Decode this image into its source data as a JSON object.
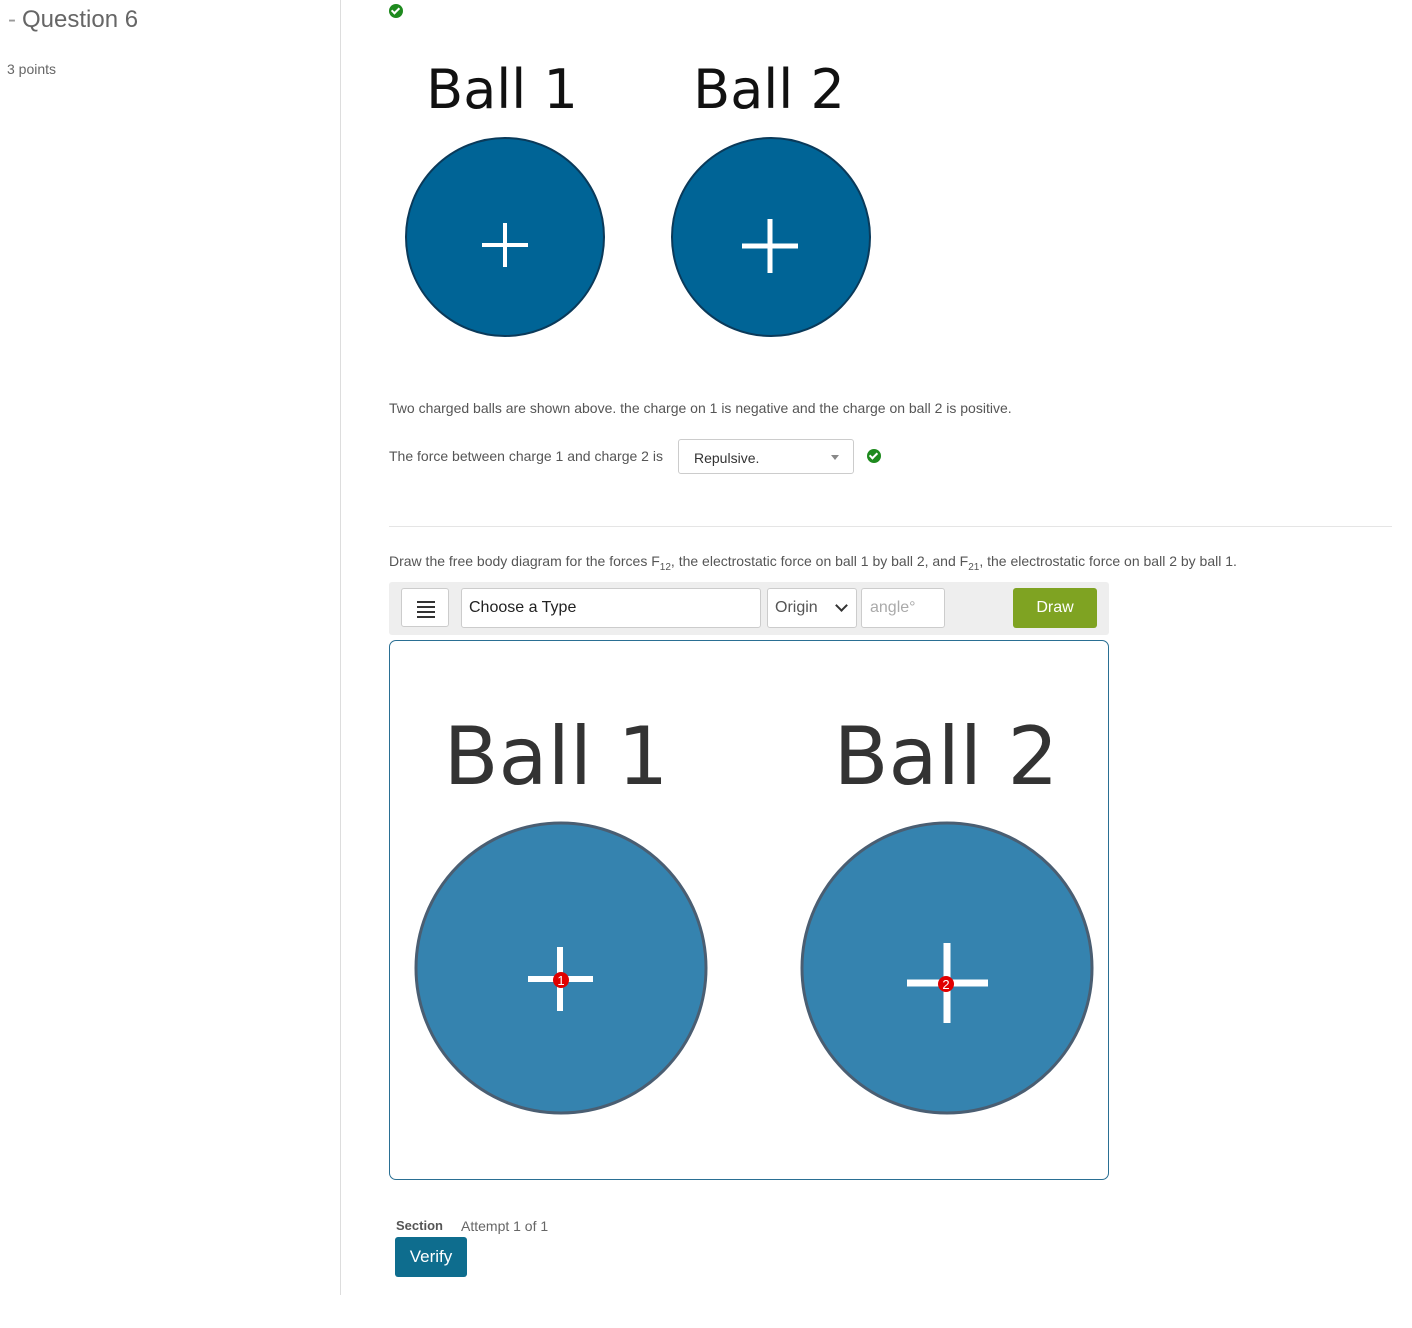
{
  "sidebar": {
    "question_title": "Question 6",
    "points": "3 points"
  },
  "figure_top": {
    "ball1_label": "Ball 1",
    "ball2_label": "Ball 2",
    "charge_symbol": "+"
  },
  "description": "Two charged balls are shown above. the charge on 1 is negative and the charge on ball 2 is positive.",
  "force_question": {
    "prompt": "The force between charge 1 and charge 2 is",
    "selected": "Repulsive."
  },
  "fbd_instruction": {
    "part1": "Draw the free body diagram for the forces F",
    "sub1": "12",
    "part2": ", the electrostatic force on ball 1 by ball 2, and F",
    "sub2": "21",
    "part3": ", the electrostatic force on ball 2 by ball 1."
  },
  "toolbar": {
    "type_value": "Choose a Type",
    "origin_value": "Origin",
    "angle_placeholder": "angle°",
    "draw_label": "Draw"
  },
  "canvas": {
    "ball1_label": "Ball 1",
    "ball2_label": "Ball 2",
    "point1_label": "1",
    "point2_label": "2"
  },
  "footer": {
    "section_label": "Section",
    "attempt_text": "Attempt 1 of 1",
    "verify_label": "Verify"
  },
  "colors": {
    "ball_dark": "#006496",
    "ball_light": "#3583af",
    "draw_button": "#7fa322",
    "verify_button": "#0e6d8e",
    "check_green": "#1e8a1e",
    "origin_point": "#e00000"
  }
}
